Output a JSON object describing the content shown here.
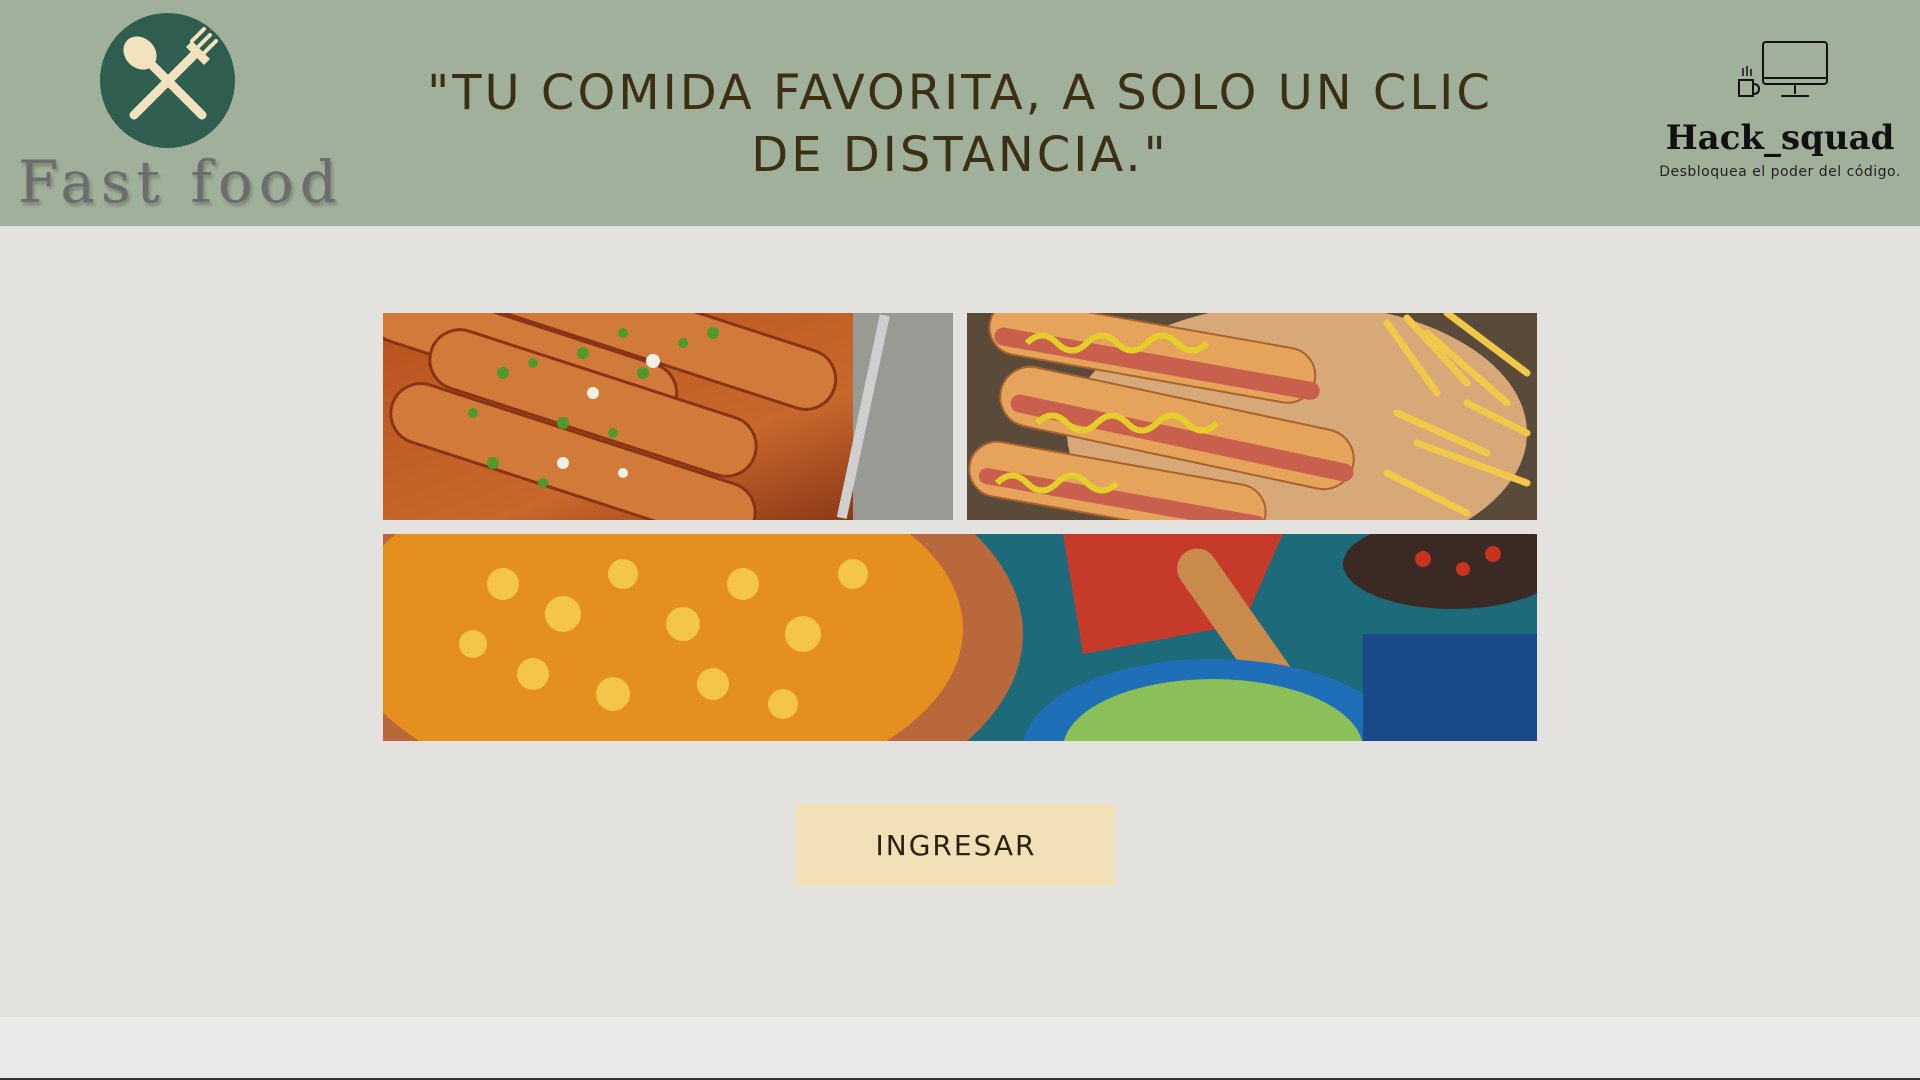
{
  "header": {
    "logo": {
      "text": "Fast food",
      "icon": "spoon-fork-icon"
    },
    "slogan": "\"TU COMIDA FAVORITA, A SOLO UN CLIC DE DISTANCIA.\"",
    "brand": {
      "name": "Hack_squad",
      "tagline": "Desbloquea el poder del código.",
      "icon": "computer-coffee-icon"
    }
  },
  "gallery": {
    "images": [
      {
        "subject": "enchiladas"
      },
      {
        "subject": "hot-dogs-with-fries"
      },
      {
        "subject": "pozole-and-mexican-dishes"
      }
    ]
  },
  "actions": {
    "enter_label": "INGRESAR"
  },
  "colors": {
    "header_bg": "#a1b09a",
    "main_bg": "#e4e2df",
    "logo_circle": "#2f5d50",
    "button_bg": "#f1e0b8",
    "slogan_text": "#3b2f14"
  }
}
